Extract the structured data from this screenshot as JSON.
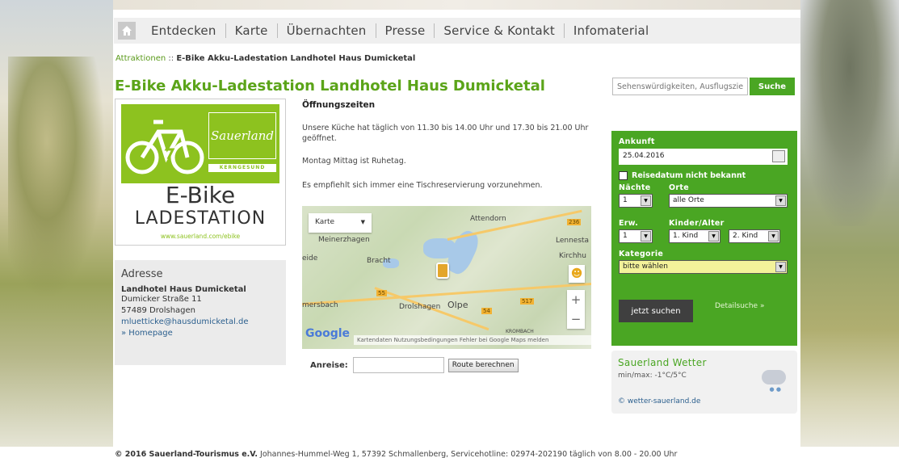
{
  "nav": {
    "items": [
      "Entdecken",
      "Karte",
      "Übernachten",
      "Presse",
      "Service & Kontakt",
      "Infomaterial"
    ]
  },
  "breadcrumb": {
    "parent": "Attraktionen",
    "separator": "::",
    "current": "E-Bike Akku-Ladestation Landhotel Haus Dumicketal"
  },
  "page_title": "E-Bike Akku-Ladestation Landhotel Haus Dumicketal",
  "search": {
    "placeholder": "Sehenswürdigkeiten, Ausflugsziele...",
    "button": "Suche"
  },
  "logo": {
    "brand": "Sauerland",
    "tagline": "KERNGESUND",
    "line1": "E-Bike",
    "line2": "LADESTATION",
    "url": "www.sauerland.com/ebike"
  },
  "address": {
    "heading": "Adresse",
    "name": "Landhotel Haus Dumicketal",
    "street": "Dumicker Straße 11",
    "city": "57489 Drolshagen",
    "email": "mluetticke@hausdumicketal.de",
    "homepage": "» Homepage"
  },
  "content": {
    "heading": "Öffnungszeiten",
    "p1": "Unsere Küche hat täglich von 11.30 bis 14.00 Uhr und 17.30 bis 21.00 Uhr geöffnet.",
    "p2": "Montag Mittag ist Ruhetag.",
    "p3": "Es empfiehlt sich immer eine Tischreservierung vorzunehmen."
  },
  "map": {
    "type_select": "Karte",
    "labels": [
      "Attendorn",
      "Meinerzhagen",
      "Bracht",
      "Lennesta",
      "Kirchhu",
      "mersbach",
      "Drolshagen",
      "Olpe",
      "eide",
      "KROMBACH"
    ],
    "road_badges": [
      "236",
      "55",
      "54",
      "517"
    ],
    "logo": "Google",
    "attribution": "Kartendaten   Nutzungsbedingungen   Fehler bei Google Maps melden"
  },
  "route": {
    "label": "Anreise:",
    "button": "Route berechnen"
  },
  "booking": {
    "arrival_label": "Ankunft",
    "arrival_value": "25.04.2016",
    "unknown_date": "Reisedatum nicht bekannt",
    "nights_label": "Nächte",
    "places_label": "Orte",
    "nights_value": "1",
    "places_value": "alle Orte",
    "adults_label": "Erw.",
    "kids_label": "Kinder/Alter",
    "adults_value": "1",
    "child1": "1. Kind",
    "child2": "2. Kind",
    "category_label": "Kategorie",
    "category_value": "bitte wählen",
    "submit": "jetzt suchen",
    "detail": "Detailsuche »"
  },
  "weather": {
    "title": "Sauerland Wetter",
    "minmax": "min/max: -1°C/5°C",
    "link": "© wetter-sauerland.de"
  },
  "footer": {
    "copyright": "© 2016 Sauerland-Tourismus e.V.",
    "address": "Johannes-Hummel-Weg 1, 57392 Schmallenberg, Servicehotline: 02974-202190 täglich von 8.00 - 20.00 Uhr"
  },
  "colors": {
    "brand_green": "#4aa623",
    "title_green": "#5ba419",
    "logo_green": "#8dc21f",
    "link_blue": "#2b5f8e"
  }
}
